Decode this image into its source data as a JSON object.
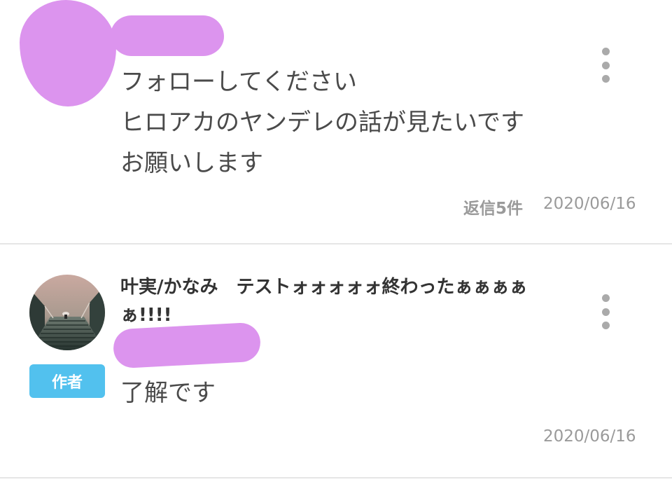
{
  "comments": [
    {
      "body_lines": [
        "フォローしてください",
        "ヒロアカのヤンデレの話が見たいです",
        "お願いします"
      ],
      "reply_count": "返信5件",
      "date": "2020/06/16"
    },
    {
      "username": "叶実/かなみ　テストォォォォォ終わったぁぁぁぁぁ!!!!",
      "badge": "作者",
      "body": "了解です",
      "date": "2020/06/16"
    }
  ],
  "colors": {
    "censor_blob": "#dc94ee",
    "author_badge": "#52c1ee",
    "meta_text": "#9a9a9a",
    "divider": "#e6e6e6"
  },
  "icons": {
    "menu": "kebab-menu-icon"
  }
}
